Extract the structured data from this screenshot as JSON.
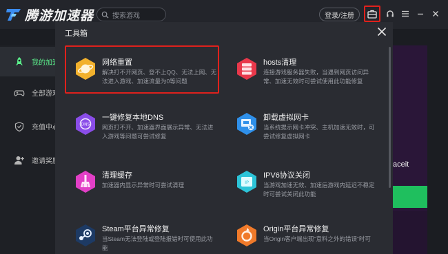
{
  "app": {
    "logo_text": "腾游加速器",
    "search_placeholder": "搜索游戏",
    "login_label": "登录/注册"
  },
  "colors": {
    "accent_green": "#5cf08c",
    "highlight_red": "#e0211c",
    "dialog_bg": "#2a2c32"
  },
  "sidebar": {
    "items": [
      {
        "label": "我的加速",
        "icon": "rocket-icon"
      },
      {
        "label": "全部游戏",
        "icon": "gamepad-icon"
      },
      {
        "label": "充值中心",
        "icon": "shield-icon"
      },
      {
        "label": "邀请奖励",
        "icon": "user-add-icon"
      }
    ]
  },
  "background": {
    "side_text": "aceit"
  },
  "toolbox": {
    "title": "工具箱",
    "tools": [
      {
        "title": "网络重置",
        "desc": "解决打不开网页、登不上QQ、无法上网、无法进入游戏、加速流量为0等问题",
        "icon": "planet-icon"
      },
      {
        "title": "hosts清理",
        "desc": "连接游戏服务器失败，当遇到网页访问异常、加速无效时可尝试使用此功能修复",
        "icon": "server-icon"
      },
      {
        "title": "一键修复本地DNS",
        "desc": "网页打不开、加速器界面展示异常、无法进入游戏等问题可尝试修复",
        "icon": "dns-icon"
      },
      {
        "title": "卸载虚拟网卡",
        "desc": "当系统提示网卡冲突、主机加速无效时，可尝试修复虚拟网卡",
        "icon": "network-card-icon"
      },
      {
        "title": "清理缓存",
        "desc": "加速器内显示异常时可尝试清理",
        "icon": "broom-icon"
      },
      {
        "title": "IPV6协议关闭",
        "desc": "当游戏加速无效、加速后游戏内延迟不稳定时可尝试关闭此功能",
        "icon": "ipv6-icon"
      },
      {
        "title": "Steam平台异常修复",
        "desc": "当Steam无法登陆或登陆报错时可使用此功能",
        "icon": "steam-icon"
      },
      {
        "title": "Origin平台异常修复",
        "desc": "当Origin客户端出现“意料之外的错误”时可",
        "icon": "origin-icon"
      }
    ]
  }
}
